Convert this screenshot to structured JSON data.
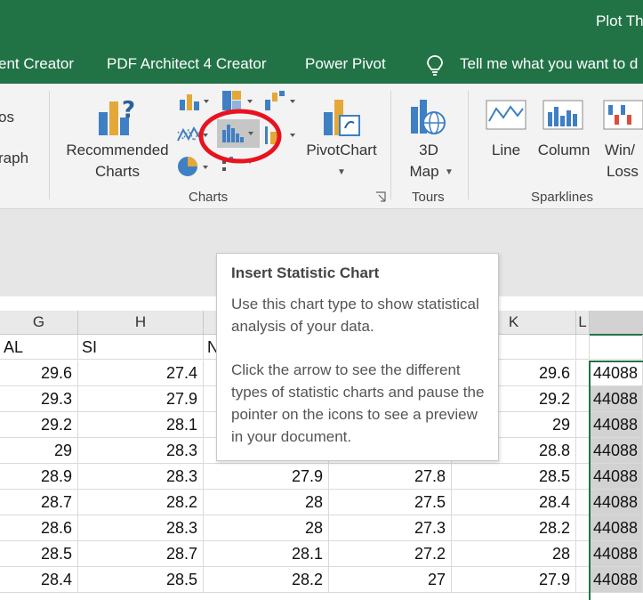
{
  "title_bar": {
    "title": "Plot Th"
  },
  "menu": [
    "ent Creator",
    "PDF Architect 4 Creator",
    "Power Pivot"
  ],
  "tell_me": "Tell me what you want to d",
  "ribbon": {
    "left_partial": [
      "os",
      "raph"
    ],
    "recommended_charts": [
      "Recommended",
      "Charts"
    ],
    "pivotchart": "PivotChart",
    "charts_group": "Charts",
    "map3d": [
      "3D",
      "Map"
    ],
    "tours_group": "Tours",
    "sparklines": {
      "line": "Line",
      "column": "Column",
      "winloss": [
        "Win/",
        "Loss"
      ]
    },
    "sparklines_group": "Sparklines",
    "highlight_color": "#e8131f"
  },
  "tooltip": {
    "title": "Insert Statistic Chart",
    "body1": "Use this chart type to show statistical analysis of your data.",
    "body2": "Click the arrow to see the different types of statistic charts and pause the pointer on the icons to see a preview in your document."
  },
  "sheet": {
    "columns": [
      "G",
      "H",
      "K",
      "L"
    ],
    "headers": {
      "g": "AL",
      "h": "SI",
      "i": "N"
    },
    "rows": [
      {
        "g": "29.6",
        "h": "27.4",
        "i": "",
        "j": "",
        "k": "29.6",
        "m": "44088"
      },
      {
        "g": "29.3",
        "h": "27.9",
        "i": "",
        "j": "",
        "k": "29.2",
        "m": "44088"
      },
      {
        "g": "29.2",
        "h": "28.1",
        "i": "",
        "j": "",
        "k": "29",
        "m": "44088"
      },
      {
        "g": "29",
        "h": "28.3",
        "i": "",
        "j": "",
        "k": "28.8",
        "m": "44088"
      },
      {
        "g": "28.9",
        "h": "28.3",
        "i": "27.9",
        "j": "27.8",
        "k": "28.5",
        "m": "44088"
      },
      {
        "g": "28.7",
        "h": "28.2",
        "i": "28",
        "j": "27.5",
        "k": "28.4",
        "m": "44088"
      },
      {
        "g": "28.6",
        "h": "28.3",
        "i": "28",
        "j": "27.3",
        "k": "28.2",
        "m": "44088"
      },
      {
        "g": "28.5",
        "h": "28.7",
        "i": "28.1",
        "j": "27.2",
        "k": "28",
        "m": "44088"
      },
      {
        "g": "28.4",
        "h": "28.5",
        "i": "28.2",
        "j": "27",
        "k": "27.9",
        "m": "44088"
      }
    ]
  }
}
